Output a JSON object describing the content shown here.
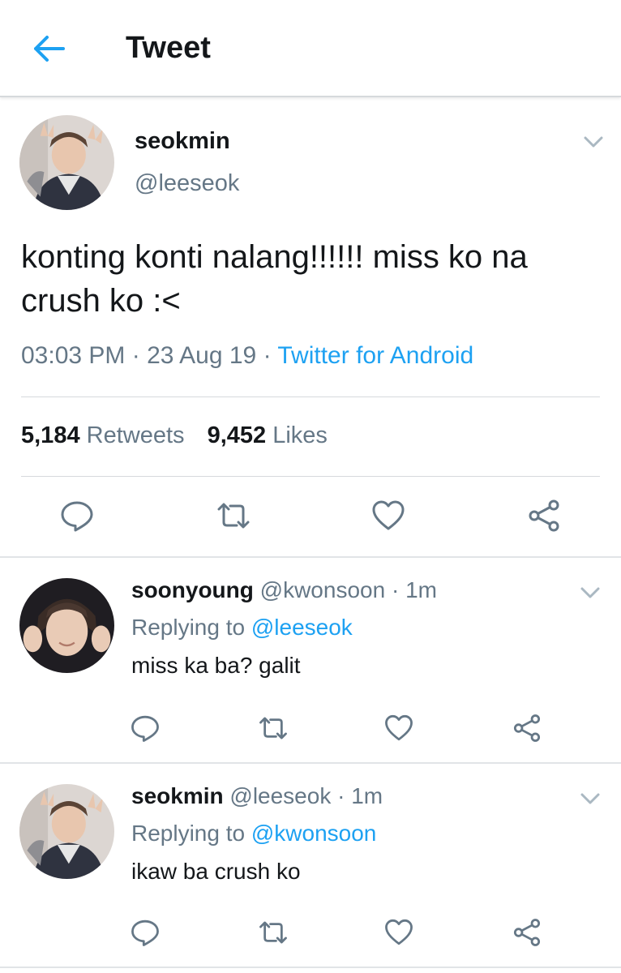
{
  "header": {
    "title": "Tweet",
    "back_icon": "back-arrow-icon",
    "accent": "#1da1f2"
  },
  "main_tweet": {
    "display_name": "seokmin",
    "handle": "@leeseok",
    "text": "konting konti nalang!!!!!! miss ko na crush ko :<",
    "time": "03:03 PM",
    "date": "23 Aug 19",
    "dot": "·",
    "source": "Twitter for Android",
    "retweets_count": "5,184",
    "retweets_label": "Retweets",
    "likes_count": "9,452",
    "likes_label": "Likes",
    "actions": [
      "reply-icon",
      "retweet-icon",
      "like-icon",
      "share-icon"
    ]
  },
  "replies": [
    {
      "display_name": "soonyoung",
      "handle": "@kwonsoon",
      "dot": "·",
      "time": "1m",
      "replying_prefix": "Replying to",
      "replying_to": "@leeseok",
      "text": "miss ka ba? galit"
    },
    {
      "display_name": "seokmin",
      "handle": "@leeseok",
      "dot": "·",
      "time": "1m",
      "replying_prefix": "Replying to",
      "replying_to": "@kwonsoon",
      "text": "ikaw ba crush ko"
    }
  ],
  "colors": {
    "primary_text": "#14171a",
    "secondary_text": "#657786",
    "link": "#1da1f2",
    "icon": "#657786"
  }
}
